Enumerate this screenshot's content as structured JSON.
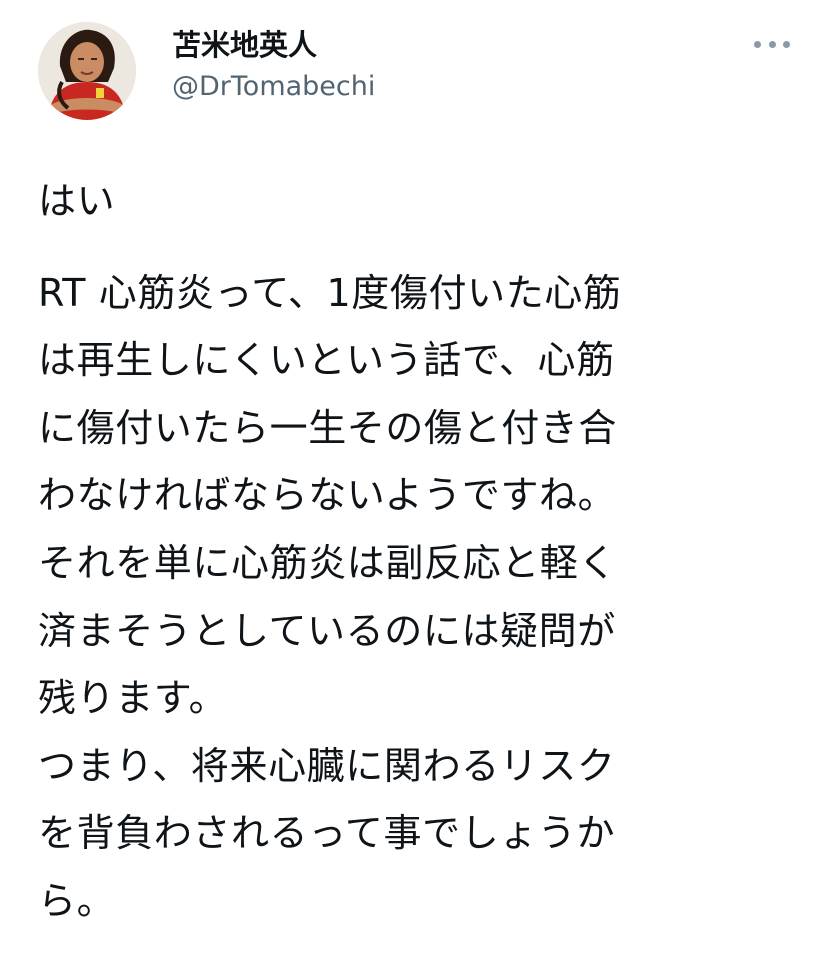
{
  "tweet": {
    "author": {
      "display_name": "苫米地英人",
      "handle": "@DrTomabechi",
      "avatar_icon": "profile-photo"
    },
    "more_icon": "more-options-icon",
    "first_line": "はい",
    "lines": [
      "RT 心筋炎って、1度傷付いた心筋",
      "は再生しにくいという話で、心筋",
      "に傷付いたら一生その傷と付き合",
      "わなければならないようですね。",
      "それを単に心筋炎は副反応と軽く",
      "済まそうとしているのには疑問が",
      "残ります。",
      "つまり、将来心臓に関わるリスク",
      "を背負わされるって事でしょうか",
      "ら。"
    ]
  }
}
